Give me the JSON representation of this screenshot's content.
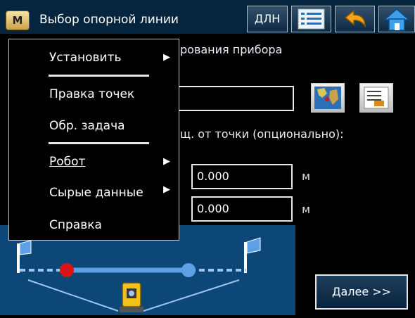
{
  "titlebar": {
    "menu_icon_label": "M",
    "title": "Выбор опорной линии",
    "dln_label": "ДЛН"
  },
  "main": {
    "partial_label_1": "рования прибора",
    "partial_label_2": "щ. от точки (опционально):",
    "field1": {
      "value": "0.000",
      "unit": "м"
    },
    "field2": {
      "value": "0.000",
      "unit": "м"
    },
    "next_label": "Далее >>"
  },
  "popup_menu": {
    "items": [
      {
        "label": "Установить",
        "has_submenu": true
      },
      {
        "label": "Правка точек",
        "has_submenu": false
      },
      {
        "label": "Обр. задача",
        "has_submenu": false
      },
      {
        "label": "Робот",
        "has_submenu": true
      },
      {
        "label": "Сырые данные",
        "has_submenu": true
      },
      {
        "label": "Справка",
        "has_submenu": false
      }
    ]
  },
  "icons": {
    "submenu_arrow": "submenu-arrow-icon",
    "map_picker": "map-icon",
    "list_picker": "point-list-icon",
    "menu_list": "list-icon",
    "back": "back-arrow-icon",
    "home": "home-icon"
  },
  "colors": {
    "titlebar_bg": "#05243d",
    "diagram_bg": "#0d4778",
    "red_point": "#d81414",
    "blue_point": "#5da0e6"
  }
}
